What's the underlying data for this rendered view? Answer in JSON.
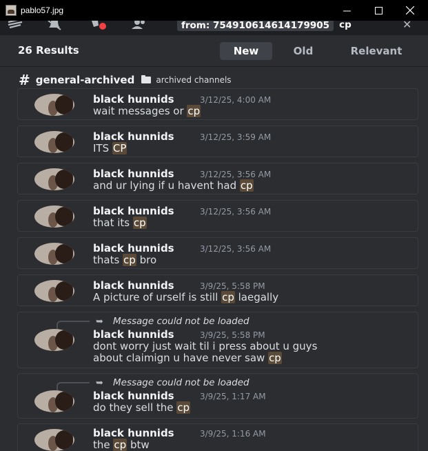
{
  "window": {
    "title": "pablo57.jpg"
  },
  "toolbar": {
    "icons": [
      "threads-icon",
      "mute-bell-icon",
      "pinned-messages-icon",
      "members-icon"
    ],
    "search_chip": "from: 754910614614179905",
    "search_query": "cp"
  },
  "results": {
    "count": "26 Results",
    "sort": [
      "New",
      "Old",
      "Relevant"
    ],
    "active_sort": "New"
  },
  "channel": {
    "name": "general-archived",
    "category": "archived channels"
  },
  "messages": [
    {
      "author": "black hunnids",
      "timestamp": "3/12/25, 4:00 AM",
      "before": "wait messages or ",
      "match": "cp",
      "after": ""
    },
    {
      "author": "black hunnids",
      "timestamp": "3/12/25, 3:59 AM",
      "before": "ITS ",
      "match": "CP",
      "after": ""
    },
    {
      "author": "black hunnids",
      "timestamp": "3/12/25, 3:56 AM",
      "before": "and ur lying if u havent had ",
      "match": "cp",
      "after": ""
    },
    {
      "author": "black hunnids",
      "timestamp": "3/12/25, 3:56 AM",
      "before": "that its ",
      "match": "cp",
      "after": ""
    },
    {
      "author": "black hunnids",
      "timestamp": "3/12/25, 3:56 AM",
      "before": "thats ",
      "match": "cp",
      "after": " bro"
    },
    {
      "author": "black hunnids",
      "timestamp": "3/9/25, 5:58 PM",
      "before": "A picture of urself is still ",
      "match": "cp",
      "after": " laegally"
    },
    {
      "author": "black hunnids",
      "timestamp": "3/9/25, 5:58 PM",
      "reply": "Message could not be loaded",
      "line1": "dont worry just wait til i press about u guys",
      "before": "about claimign u have never saw ",
      "match": "cp",
      "after": ""
    },
    {
      "author": "black hunnids",
      "timestamp": "3/9/25, 1:17 AM",
      "reply": "Message could not be loaded",
      "before": "do they sell the ",
      "match": "cp",
      "after": ""
    },
    {
      "author": "black hunnids",
      "timestamp": "3/9/25, 1:16 AM",
      "before": "the ",
      "match": "cp",
      "after": " btw"
    }
  ]
}
